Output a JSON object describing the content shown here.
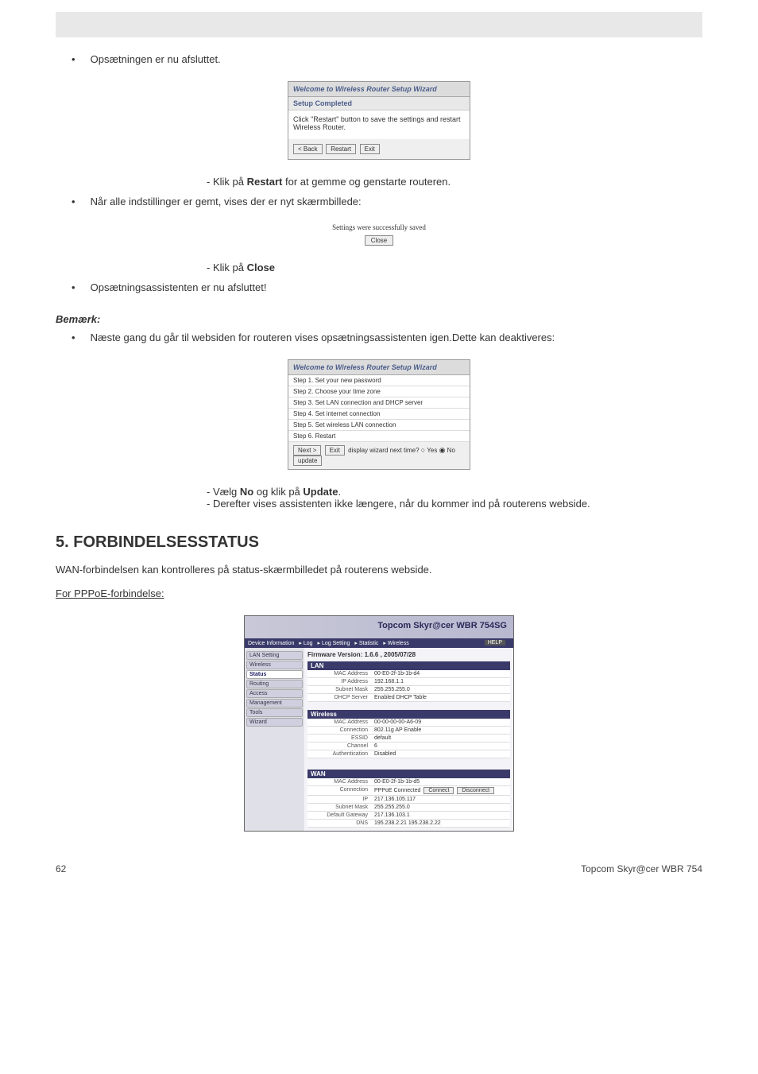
{
  "bullets": {
    "b1": "Opsætningen er nu afsluttet.",
    "b2_pre": "- Klik på ",
    "b2_bold": "Restart",
    "b2_post": " for at gemme og genstarte routeren.",
    "b3": "Når alle indstillinger er gemt, vises der er nyt skærmbillede:",
    "b4_pre": "- Klik på ",
    "b4_bold": "Close",
    "b5": "Opsætningsassistenten er nu afsluttet!",
    "note": "Bemærk:",
    "b6": "Næste gang du går til websiden for routeren vises opsætningsassistenten igen.Dette kan deaktiveres:",
    "b7_pre": "- Vælg ",
    "b7_bold1": "No",
    "b7_mid": " og klik på ",
    "b7_bold2": "Update",
    "b7_post": ".",
    "b8": "- Derefter vises assistenten ikke længere, når du kommer ind på routerens webside."
  },
  "wizard1": {
    "title": "Welcome to Wireless Router Setup Wizard",
    "sub": "Setup Completed",
    "body": "Click \"Restart\" button to save the settings and restart Wireless Router.",
    "back": "< Back",
    "restart": "Restart",
    "exit": "Exit"
  },
  "saved": {
    "msg": "Settings were successfully saved",
    "close": "Close"
  },
  "wizard2": {
    "title": "Welcome to Wireless Router Setup Wizard",
    "steps": [
      "Step 1. Set your new password",
      "Step 2. Choose your time zone",
      "Step 3. Set LAN connection and DHCP server",
      "Step 4. Set internet connection",
      "Step 5. Set wireless LAN connection",
      "Step 6. Restart"
    ],
    "next": "Next >",
    "exit": "Exit",
    "display": "display wizard next time?",
    "yes": "Yes",
    "no": "No",
    "update": "update"
  },
  "section5": {
    "heading": "5.  FORBINDELSESSTATUS",
    "intro": "WAN-forbindelsen kan kontrolleres på status-skærmbilledet på routerens webside.",
    "pppoe": "For PPPoE-forbindelse:"
  },
  "router": {
    "brand": "Topcom Skyr@cer WBR 754SG",
    "nav": [
      "Device Information",
      "Log",
      "Log Setting",
      "Statistic",
      "Wireless"
    ],
    "help": "HELP",
    "fw": "Firmware Version: 1.6.6 , 2005/07/28",
    "sidebar": [
      "LAN Setting",
      "Wireless",
      "Status",
      "Routing",
      "Access",
      "Management",
      "Tools",
      "Wizard"
    ],
    "lan": {
      "hdr": "LAN",
      "mac_k": "MAC Address",
      "mac_v": "00-E0-2f-1b-1b-d4",
      "ip_k": "IP Address",
      "ip_v": "192.168.1.1",
      "mask_k": "Subnet Mask",
      "mask_v": "255.255.255.0",
      "dhcp_k": "DHCP Server",
      "dhcp_v": "Enabled  DHCP Table"
    },
    "wl": {
      "hdr": "Wireless",
      "mac_k": "MAC Address",
      "mac_v": "00-00-00-00-A6-09",
      "conn_k": "Connection",
      "conn_v": "802.11g AP Enable",
      "essid_k": "ESSID",
      "essid_v": "default",
      "ch_k": "Channel",
      "ch_v": "6",
      "auth_k": "Authentication",
      "auth_v": "Disabled"
    },
    "wan": {
      "hdr": "WAN",
      "mac_k": "MAC Address",
      "mac_v": "00-E0-2f-1b-1b-d5",
      "conn_k": "Connection",
      "conn_v": "PPPoE Connected",
      "connect": "Connect",
      "disconnect": "Disconnect",
      "ip_k": "IP",
      "ip_v": "217.136.105.117",
      "mask_k": "Subnet Mask",
      "mask_v": "255.255.255.0",
      "gw_k": "Default Gateway",
      "gw_v": "217.136.103.1",
      "dns_k": "DNS",
      "dns_v": "195.238.2.21   195.238.2.22"
    }
  },
  "footer": {
    "page": "62",
    "product": "Topcom Skyr@cer WBR 754"
  }
}
